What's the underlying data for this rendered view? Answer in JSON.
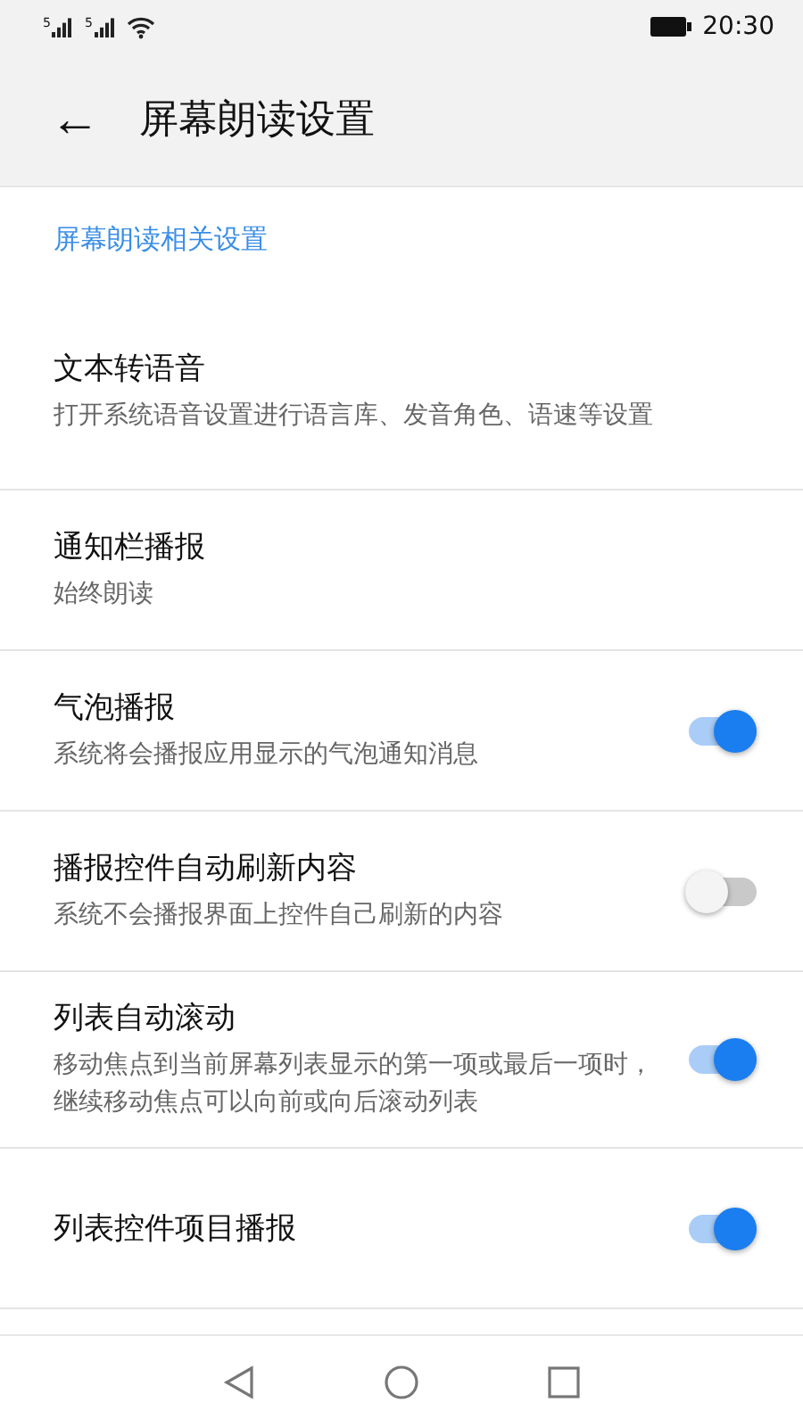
{
  "status_bar": {
    "sim_labels": [
      "5",
      "5"
    ],
    "time": "20:30"
  },
  "header": {
    "back": "←",
    "title": "屏幕朗读设置"
  },
  "section": {
    "title": "屏幕朗读相关设置"
  },
  "items": [
    {
      "kind": "link",
      "title": "文本转语音",
      "subtitle": "打开系统语音设置进行语言库、发音角色、语速等设置"
    },
    {
      "kind": "link",
      "title": "通知栏播报",
      "subtitle": "始终朗读"
    },
    {
      "kind": "toggle",
      "title": "气泡播报",
      "subtitle": "系统将会播报应用显示的气泡通知消息",
      "on": true
    },
    {
      "kind": "toggle",
      "title": "播报控件自动刷新内容",
      "subtitle": "系统不会播报界面上控件自己刷新的内容",
      "on": false
    },
    {
      "kind": "toggle",
      "title": "列表自动滚动",
      "subtitle": "移动焦点到当前屏幕列表显示的第一项或最后一项时，继续移动焦点可以向前或向后滚动列表",
      "on": true
    },
    {
      "kind": "toggle",
      "title": "列表控件项目播报",
      "on": true
    }
  ]
}
